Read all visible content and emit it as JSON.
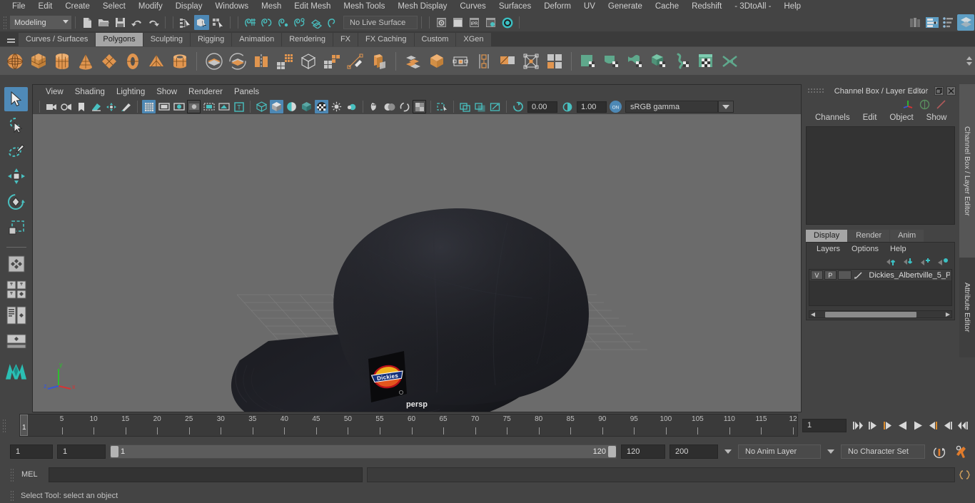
{
  "menubar": {
    "items": [
      "File",
      "Edit",
      "Create",
      "Select",
      "Modify",
      "Display",
      "Windows",
      "Mesh",
      "Edit Mesh",
      "Mesh Tools",
      "Mesh Display",
      "Curves",
      "Surfaces",
      "Deform",
      "UV",
      "Generate",
      "Cache",
      "Redshift",
      "- 3DtoAll -",
      "Help"
    ]
  },
  "statusbar": {
    "mode": "Modeling",
    "live_surface": "No Live Surface",
    "icons": [
      "new-scene-icon",
      "open-scene-icon",
      "save-scene-icon",
      "undo-icon",
      "redo-icon",
      "select-by-hierarchy-icon",
      "select-by-object-icon",
      "select-by-component-icon",
      "snap-to-grid-icon",
      "snap-to-curve-icon",
      "snap-to-point-icon",
      "snap-to-projected-center-icon",
      "snap-to-view-plane-icon",
      "make-live-icon",
      "render-current-frame-icon",
      "render-sequence-icon",
      "ipr-render-icon",
      "render-settings-icon",
      "hypershade-icon",
      "outliner-panel-icon",
      "attribute-editor-icon",
      "channel-box-icon",
      "modeling-toolkit-icon"
    ]
  },
  "shelf": {
    "tabs": [
      "Curves / Surfaces",
      "Polygons",
      "Sculpting",
      "Rigging",
      "Animation",
      "Rendering",
      "FX",
      "FX Caching",
      "Custom",
      "XGen"
    ],
    "active_tab": "Polygons",
    "icons": [
      "poly-sphere-icon",
      "poly-cube-icon",
      "poly-cylinder-icon",
      "poly-cone-icon",
      "poly-plane-icon",
      "poly-torus-icon",
      "poly-pyramid-icon",
      "poly-pipe-icon",
      "boolean-union-icon",
      "boolean-difference-icon",
      "combine-icon",
      "smooth-icon",
      "mirror-geometry-icon",
      "quad-draw-icon",
      "multi-cut-icon",
      "extrude-icon",
      "bevel-icon",
      "bridge-icon",
      "target-weld-icon",
      "insert-edge-loop-icon",
      "offset-edge-loop-icon",
      "connect-components-icon",
      "detach-icon",
      "uv-editor-icon",
      "planar-map-icon",
      "cylindrical-map-icon",
      "automatic-map-icon",
      "unfold-icon",
      "uv-snapshot-icon",
      "uv-cut-sew-icon"
    ]
  },
  "toolbox": {
    "tools": [
      "select-tool",
      "lasso-select-tool",
      "paint-select-tool",
      "move-tool",
      "rotate-tool",
      "scale-tool",
      "last-tool-used",
      "single-perspective-view-layout",
      "four-view-layout",
      "persp-outliner-layout",
      "persp-graph-editor-layout",
      "maya-logo"
    ],
    "selected": "select-tool"
  },
  "viewport": {
    "menu": [
      "View",
      "Shading",
      "Lighting",
      "Show",
      "Renderer",
      "Panels"
    ],
    "camera_label": "persp",
    "exposure": "0.00",
    "gamma": "1.00",
    "color_profile": "sRGB gamma",
    "axis": {
      "x": "x",
      "y": "y",
      "z": "z"
    },
    "toolbar_icons": [
      "select-camera-icon",
      "camera-attributes-icon",
      "bookmark-icon",
      "image-plane-icon",
      "two-d-pan-zoom-icon",
      "grease-pencil-icon",
      "grid-toggle-icon",
      "film-gate-icon",
      "resolution-gate-icon",
      "gate-mask-icon",
      "film-origin-icon",
      "camera-names-icon",
      "view-axis-icon",
      "wireframe-icon",
      "smooth-shade-icon",
      "flat-shade-icon",
      "shaded-wireframe-icon",
      "textured-icon",
      "use-default-lighting-icon",
      "use-all-lights-icon",
      "shadows-icon",
      "ambient-occlusion-icon",
      "motion-blur-icon",
      "multisample-icon",
      "isolate-select-icon",
      "xray-icon",
      "xray-joints-icon",
      "xray-active-components-icon",
      "exposure-icon",
      "gamma-icon",
      "color-management-icon"
    ]
  },
  "channel_box": {
    "title": "Channel Box / Layer Editor",
    "menu": [
      "Channels",
      "Edit",
      "Object",
      "Show"
    ],
    "header_icons": [
      "axis-display-icon",
      "dim-toggle-icon",
      "slash-icon"
    ],
    "window_buttons": [
      "restore-icon",
      "close-icon"
    ]
  },
  "layer_editor": {
    "tabs": [
      "Display",
      "Render",
      "Anim"
    ],
    "active_tab": "Display",
    "menu": [
      "Layers",
      "Options",
      "Help"
    ],
    "buttons": [
      "move-layer-up-icon",
      "move-layer-down-icon",
      "new-layer-icon",
      "new-layer-from-selected-icon"
    ],
    "layers": [
      {
        "visibility": "V",
        "playback": "P",
        "color": "",
        "name": "Dickies_Albertville_5_P"
      }
    ]
  },
  "side_tabs": [
    "Channel Box / Layer Editor",
    "Attribute Editor"
  ],
  "timeline": {
    "tick_labels": [
      "5",
      "10",
      "15",
      "20",
      "25",
      "30",
      "35",
      "40",
      "45",
      "50",
      "55",
      "60",
      "65",
      "70",
      "75",
      "80",
      "85",
      "90",
      "95",
      "100",
      "105",
      "110",
      "115",
      "12"
    ],
    "playhead_frame": "1",
    "current_frame": "1",
    "playback_buttons": [
      "go-to-start-icon",
      "step-back-keyframe-icon",
      "step-back-frame-icon",
      "play-backwards-icon",
      "play-forwards-icon",
      "step-forward-frame-icon",
      "step-forward-keyframe-icon",
      "go-to-end-icon"
    ]
  },
  "range": {
    "anim_start": "1",
    "range_start": "1",
    "slider_start": "1",
    "slider_end": "120",
    "range_end": "120",
    "anim_end": "200",
    "anim_layer": "No Anim Layer",
    "character_set": "No Character Set",
    "buttons": [
      "auto-keyframe-icon",
      "animation-preferences-icon"
    ]
  },
  "mel": {
    "label": "MEL",
    "input_value": "",
    "output_value": "",
    "script-editor-button": "script-editor-icon"
  },
  "status": {
    "message": "Select Tool: select an object"
  },
  "colors": {
    "accent_blue": "#4d88b5",
    "orange": "#dd9a5c",
    "teal": "#3ec3c0",
    "green": "#5fa88c",
    "panel_bg": "#444444",
    "viewport_bg": "#6b6b6b"
  }
}
